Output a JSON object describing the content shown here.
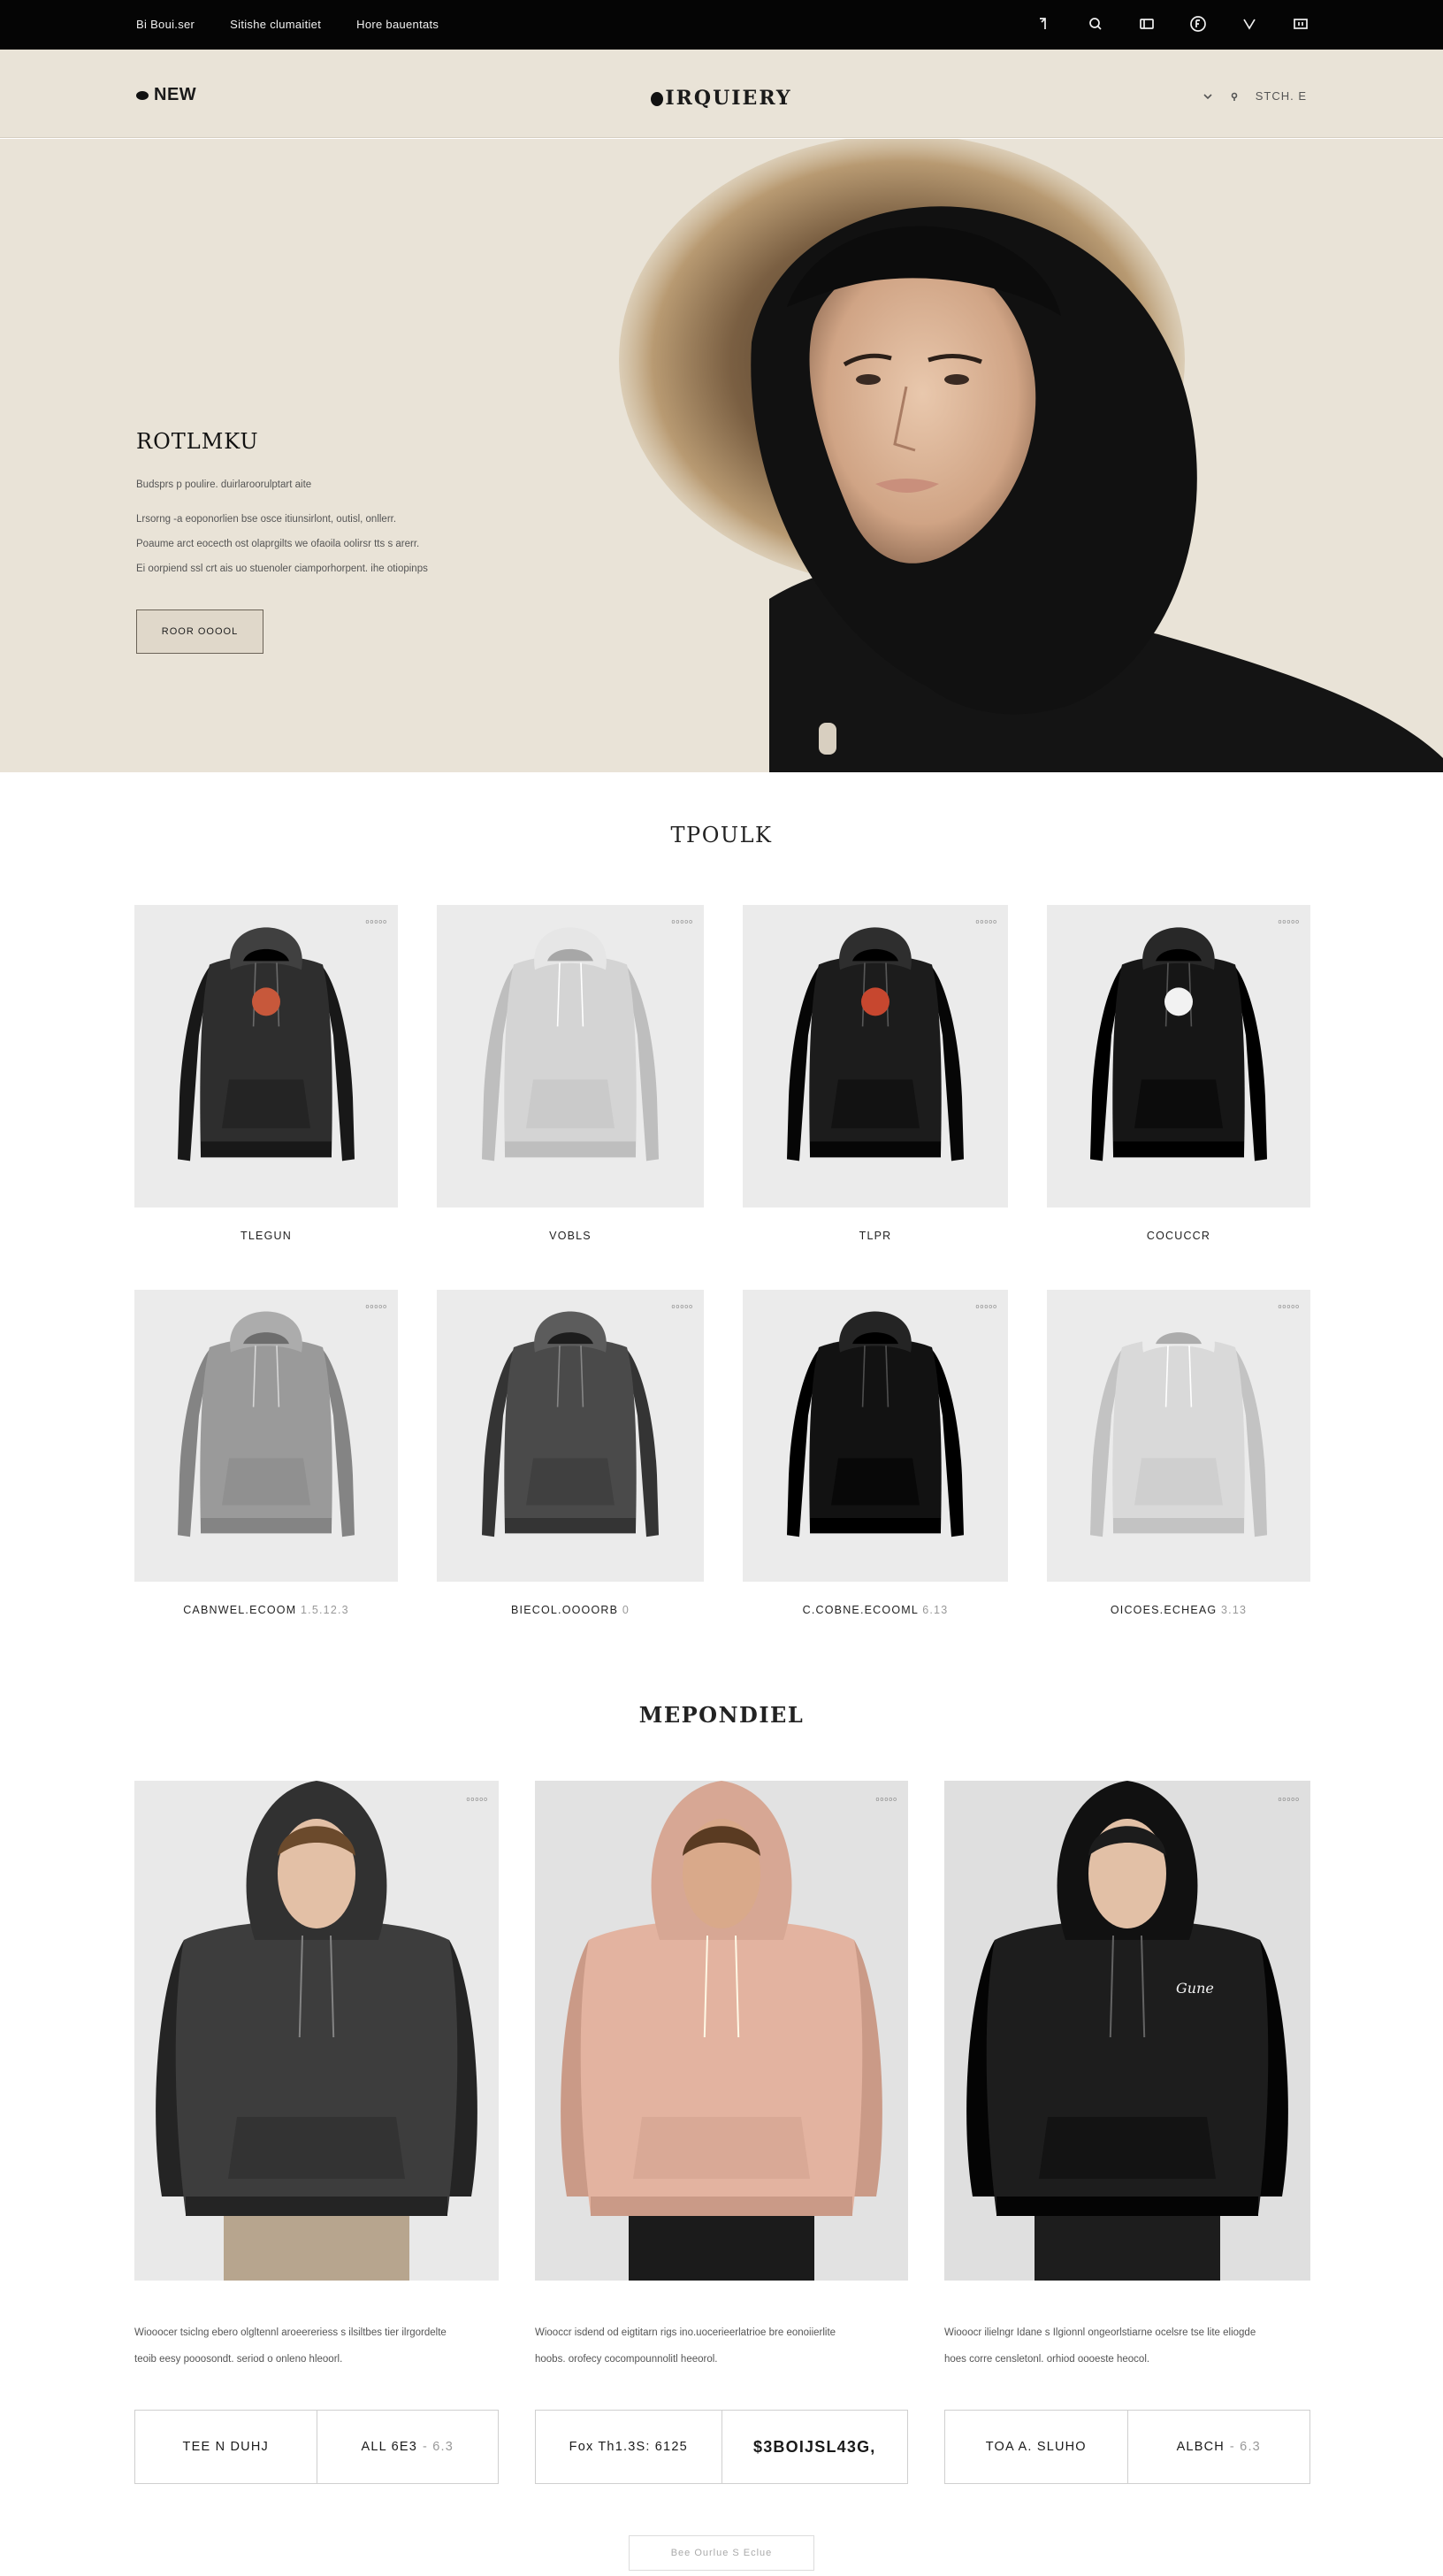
{
  "topbar": {
    "links": [
      "Bi Boui.ser",
      "Sitishe clumaitiet",
      "Hore bauentats"
    ],
    "icons": [
      "user-icon",
      "search-icon",
      "cart-icon",
      "account-circle-icon",
      "heart-icon",
      "bag-icon"
    ]
  },
  "header": {
    "new_label": "NEW",
    "logo": "IRQUIERY",
    "right_text": "STCH. E"
  },
  "hero": {
    "title": "ROTLMKU",
    "subtitle": "Budsprs p poulire. duirlaroorulptart aite",
    "body": [
      "Lrsorng -a eoponorlien bse osce itiunsirlont, outisl, onllerr.",
      "Poaume arct eocecth ost olaprgilts we ofaoila oolirsr tts s arerr.",
      "Ei oorpiend ssl crt ais uo stuenoler ciamporhorpent. ihe otiopinps"
    ],
    "cta": "ROOR OOOOL"
  },
  "products": {
    "title": "TPOULK",
    "tag": "ooooo",
    "items": [
      {
        "name": "TLEGUN",
        "suffix": "",
        "color": "#2e2e2e",
        "logo": "#c7583b"
      },
      {
        "name": "VOBLS",
        "suffix": "",
        "color": "#d4d4d4",
        "logo": ""
      },
      {
        "name": "TLPR",
        "suffix": "",
        "color": "#1c1c1c",
        "logo": "#c7472f"
      },
      {
        "name": "COCUCCR",
        "suffix": "",
        "color": "#161616",
        "logo": "#f2f2f2"
      },
      {
        "name": "CABNWEL.ECOOM",
        "suffix": "1.5.12.3",
        "color": "#9a9a9a",
        "logo": ""
      },
      {
        "name": "BIECOL.OOOORB",
        "suffix": "0",
        "color": "#4a4a4a",
        "logo": ""
      },
      {
        "name": "C.COBNE.ECOOML",
        "suffix": "6.13",
        "color": "#121212",
        "logo": ""
      },
      {
        "name": "OICOES.ECHEAG",
        "suffix": "3.13",
        "color": "#d9d9d9",
        "logo": ""
      }
    ]
  },
  "featured": {
    "title": "MEPONDIEL",
    "tag": "ooooo",
    "items": [
      {
        "desc1": "Wiooocer tsiclng ebero olgltennl aroeereriess s ilsiltbes tier ilrgordelte",
        "desc2": "teoib eesy pooosondt. seriod o onleno hleoorl.",
        "col1": "TEE N DUHJ",
        "col2": "ALL 6E3",
        "col2_muted": "- 6.3",
        "hoodie": "#3d3d3d",
        "skin": "#e3c0a6",
        "hair": "#6b4a2c",
        "pants": "#b7a58e",
        "bg": "#e9e9e9",
        "chest_text": "",
        "bold": false
      },
      {
        "desc1": "Wiooccr isdend od eigtitarn rigs ino.uocerieerlatrioe bre eonoiierlite",
        "desc2": "hoobs. orofecy cocompounnolitl heeorol.",
        "col1": "Fox  Th1.3S: 6125",
        "col2": "$3BOIJSL43G,",
        "col2_muted": "",
        "hoodie": "#e3b3a0",
        "skin": "#d9a98a",
        "hair": "#5a3b22",
        "pants": "#1b1b1b",
        "bg": "#e2e2e2",
        "chest_text": "",
        "bold": true
      },
      {
        "desc1": "Wiooocr ilielngr Idane s Ilgionnl ongeorlstiarne ocelsre tse lite eliogde",
        "desc2": "hoes corre censletonl. orhiod oooeste heocol.",
        "col1": "TOA  A. SLUHO",
        "col2": "ALBCH",
        "col2_muted": "- 6.3",
        "hoodie": "#1d1d1d",
        "skin": "#e2c0a6",
        "hair": "#1c1c1c",
        "pants": "#1d1d1d",
        "bg": "#dfdfdf",
        "chest_text": "Gune",
        "bold": false
      }
    ]
  },
  "footer": {
    "load_more": "Bee Ourlue S Eclue"
  }
}
